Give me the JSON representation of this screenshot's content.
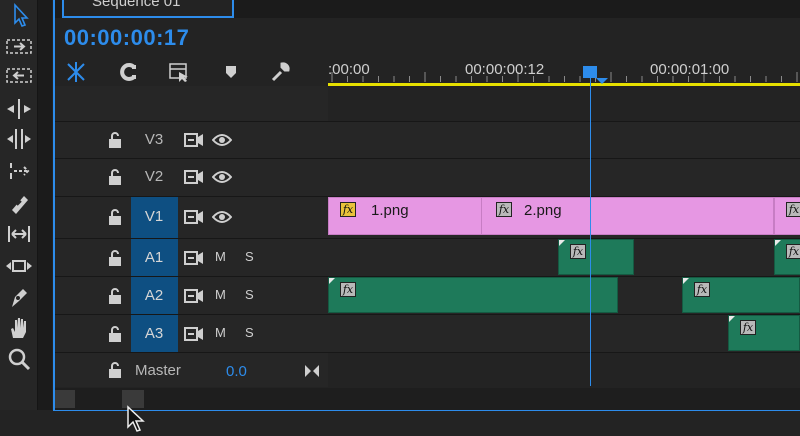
{
  "sequence": {
    "tab_title": "Sequence 01",
    "timecode": "00:00:00:17"
  },
  "tools": [
    {
      "icon": "selection-tool-icon",
      "active": true
    },
    {
      "icon": "track-select-forward-icon"
    },
    {
      "icon": "track-select-backward-icon"
    },
    {
      "icon": "ripple-edit-icon"
    },
    {
      "icon": "rolling-edit-icon"
    },
    {
      "icon": "rate-stretch-icon"
    },
    {
      "icon": "razor-icon"
    },
    {
      "icon": "slip-icon"
    },
    {
      "icon": "slide-icon"
    },
    {
      "icon": "pen-icon"
    },
    {
      "icon": "hand-icon"
    },
    {
      "icon": "zoom-icon"
    }
  ],
  "controls": [
    "snap-icon",
    "linked-selection-icon",
    "add-marker-options-icon",
    "marker-icon",
    "wrench-icon"
  ],
  "ruler": {
    "labels": [
      ":00:00",
      "00:00:00:12",
      "00:00:01:00"
    ]
  },
  "tracks": {
    "video": [
      {
        "name": "V3",
        "targeted": false
      },
      {
        "name": "V2",
        "targeted": false
      },
      {
        "name": "V1",
        "targeted": true
      }
    ],
    "audio": [
      {
        "name": "A1",
        "mute": "M",
        "solo": "S"
      },
      {
        "name": "A2",
        "mute": "M",
        "solo": "S"
      },
      {
        "name": "A3",
        "mute": "M",
        "solo": "S"
      }
    ],
    "master": {
      "name": "Master",
      "value": "0.0"
    }
  },
  "clips": {
    "video": [
      {
        "label": "1.png",
        "fx": "fx"
      },
      {
        "label": "2.png",
        "fx": "fx"
      },
      {
        "label": "",
        "fx": "fx"
      }
    ],
    "audio_fx": "fx"
  },
  "colors": {
    "accent": "#2d8ceb",
    "video_clip": "#e697e3",
    "audio_clip": "#1e7a5a",
    "work_area": "#e6e000",
    "track_target": "#0e4f82"
  }
}
